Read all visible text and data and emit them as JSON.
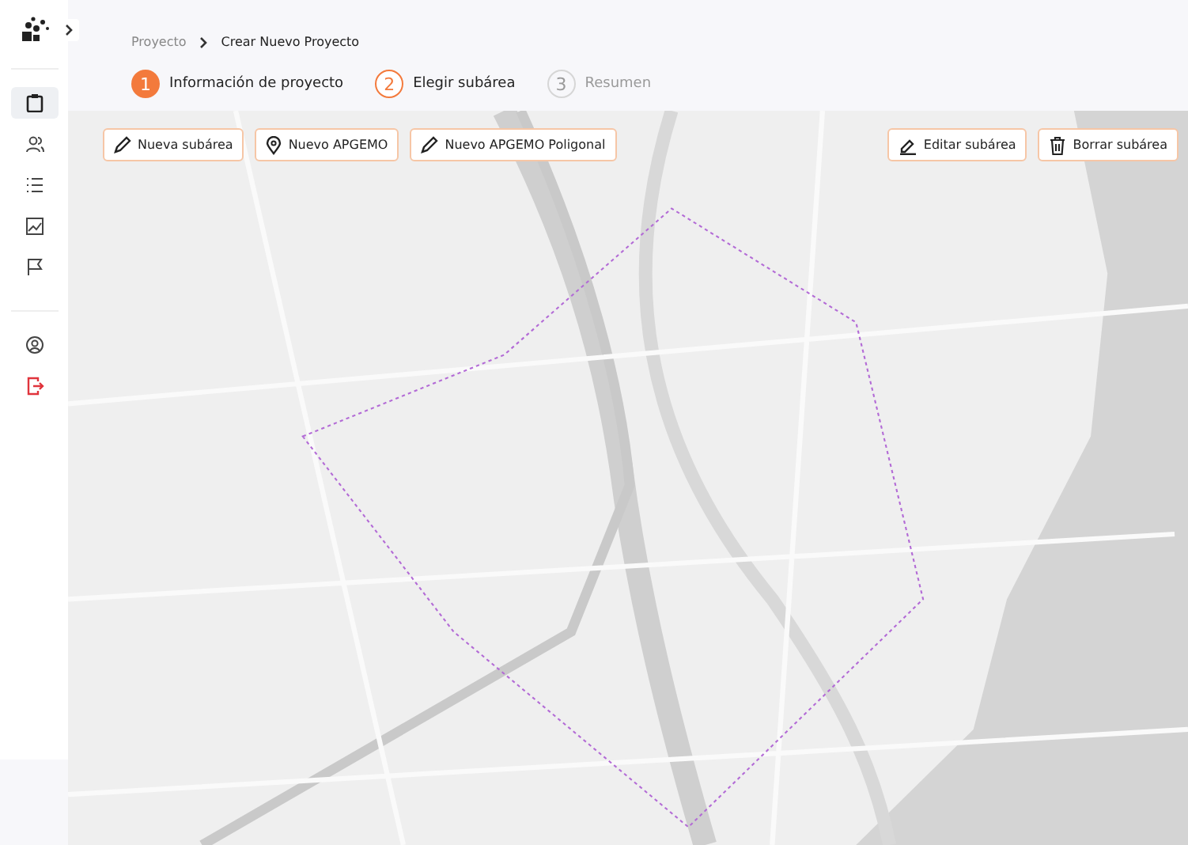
{
  "sidebar": {
    "items": [
      {
        "kind": "clipboard",
        "selected": true
      },
      {
        "kind": "users",
        "selected": false
      },
      {
        "kind": "list",
        "selected": false
      },
      {
        "kind": "chart",
        "selected": false
      },
      {
        "kind": "flag",
        "selected": false
      },
      {
        "kind": "profile",
        "selected": false
      },
      {
        "kind": "logout",
        "selected": false
      }
    ]
  },
  "breadcrumb": [
    "Proyecto",
    "Crear Nuevo Proyecto"
  ],
  "steps": [
    {
      "number": "1",
      "label": "Información de proyecto",
      "completed": true,
      "selected": false
    },
    {
      "number": "2",
      "label": "Elegir subárea",
      "completed": false,
      "selected": true
    },
    {
      "number": "3",
      "label": "Resumen",
      "completed": false,
      "selected": false
    }
  ],
  "map_toolbar": {
    "left": [
      {
        "label": "Nueva subárea",
        "kind": "pencil"
      },
      {
        "label": "Nuevo APGEMO",
        "kind": "pin"
      },
      {
        "label": "Nuevo APGEMO Poligonal",
        "kind": "pencil"
      }
    ],
    "right": [
      {
        "label": "Editar subárea",
        "kind": "edit"
      },
      {
        "label": "Borrar subárea",
        "kind": "trash"
      }
    ]
  }
}
